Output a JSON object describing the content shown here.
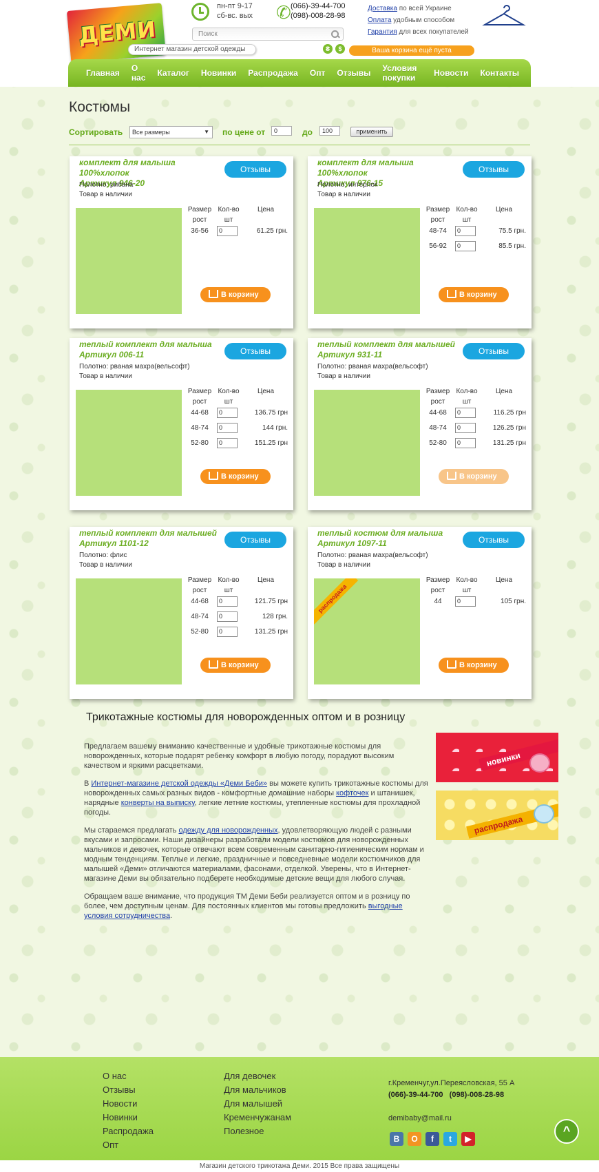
{
  "header": {
    "logo_text": "ДЕМИ",
    "tagline": "Интернет магазин детской одежды",
    "hours_line1": "пн-пт 9-17",
    "hours_line2": "сб-вс. вых",
    "phone1": "(066)-39-44-700",
    "phone2": "(098)-008-28-98",
    "search_placeholder": "Поиск",
    "currency1": "₴",
    "currency2": "$",
    "cart_status": "Ваша корзина ещё пуста",
    "links": [
      {
        "link": "Доставка",
        "rest": " по всей Украине"
      },
      {
        "link": "Оплата",
        "rest": " удобным способом"
      },
      {
        "link": "Гарантия",
        "rest": " для всех покупателей"
      }
    ]
  },
  "nav": [
    "Главная",
    "О нас",
    "Каталог",
    "Новинки",
    "Распродажа",
    "Опт",
    "Отзывы",
    "Условия покупки",
    "Новости",
    "Контакты"
  ],
  "page_title": "Костюмы",
  "sort": {
    "label": "Сортировать",
    "size_select": "Все размеры",
    "price_from_label": "по цене от",
    "price_from": "0",
    "price_to_label": "до",
    "price_to": "100",
    "apply": "применить"
  },
  "table_headers": {
    "size_line1": "Размер",
    "size_line2": "рост",
    "qty_line1": "Кол-во",
    "qty_line2": "шт",
    "price": "Цена"
  },
  "reviews_label": "Отзывы",
  "cart_label": "В корзину",
  "products": [
    {
      "title": "комплект для малыша 100%хлопок",
      "sku": "Артикул 946-20",
      "fabric": "Полотно: рибана",
      "stock": "Товар в наличии",
      "rows": [
        {
          "size": "36-56",
          "qty": "0",
          "price": "61.25 грн."
        }
      ]
    },
    {
      "title": "комплект для малыша 100%хлопок",
      "sku": "Артикул 976-15",
      "fabric": "Полотно: интерлок",
      "stock": "Товар в наличии",
      "rows": [
        {
          "size": "48-74",
          "qty": "0",
          "price": "75.5 грн."
        },
        {
          "size": "56-92",
          "qty": "0",
          "price": "85.5 грн."
        }
      ]
    },
    {
      "title": "теплый комплект для малыша",
      "sku": "Артикул 006-11",
      "fabric": "Полотно: рваная махра(вельсофт)",
      "stock": "Товар в наличии",
      "rows": [
        {
          "size": "44-68",
          "qty": "0",
          "price": "136.75 грн"
        },
        {
          "size": "48-74",
          "qty": "0",
          "price": "144 грн."
        },
        {
          "size": "52-80",
          "qty": "0",
          "price": "151.25 грн"
        }
      ]
    },
    {
      "title": "теплый комплект для малышей",
      "sku": "Артикул 931-11",
      "fabric": "Полотно: рваная махра(вельсофт)",
      "stock": "Товар в наличии",
      "rows": [
        {
          "size": "44-68",
          "qty": "0",
          "price": "116.25 грн"
        },
        {
          "size": "48-74",
          "qty": "0",
          "price": "126.25 грн"
        },
        {
          "size": "52-80",
          "qty": "0",
          "price": "131.25 грн"
        }
      ]
    },
    {
      "title": "теплый комплект для малышей",
      "sku": "Артикул 1101-12",
      "fabric": "Полотно: флис",
      "stock": "Товар в наличии",
      "rows": [
        {
          "size": "44-68",
          "qty": "0",
          "price": "121.75 грн"
        },
        {
          "size": "48-74",
          "qty": "0",
          "price": "128 грн."
        },
        {
          "size": "52-80",
          "qty": "0",
          "price": "131.25 грн"
        }
      ]
    },
    {
      "title": "теплый костюм для малыша",
      "sku": "Артикул 1097-11",
      "fabric": "Полотно: рваная махра(вельсофт)",
      "stock": "Товар в наличии",
      "badge": "распродажа",
      "rows": [
        {
          "size": "44",
          "qty": "0",
          "price": "105 грн."
        }
      ]
    }
  ],
  "seo": {
    "title": "Трикотажные костюмы для новорожденных оптом и в розницу",
    "p1": "Предлагаем вашему вниманию качественные и удобные трикотажные костюмы для новорожденных, которые подарят ребенку комфорт в любую погоду, порадуют высоким качеством и яркими расцветками.",
    "p2_a": "В ",
    "p2_link1": "Интернет-магазине детской одежды «Деми Беби»",
    "p2_b": " вы можете купить трикотажные костюмы для новорожденных самых разных видов - комфортные домашние наборы ",
    "p2_link2": "кофточек",
    "p2_c": " и штанишек, нарядные ",
    "p2_link3": "конверты на выписку",
    "p2_d": ", легкие летние костюмы, утепленные костюмы для прохладной погоды.",
    "p3_a": "Мы стараемся предлагать ",
    "p3_link": "одежду для новорожденных",
    "p3_b": ", удовлетворяющую людей с разными вкусами и запросами. Наши дизайнеры разработали модели костюмов для новорожденных мальчиков и девочек, которые отвечают всем современным санитарно-гигиеническим нормам и модным тенденциям. Теплые и легкие, праздничные и повседневные модели костюмчиков для малышей «Деми» отличаются материалами, фасонами, отделкой. Уверены, что в Интернет-магазине Деми вы обязательно подберете необходимые детские вещи для любого случая.",
    "p4_a": "Обращаем ваше внимание, что продукция ТМ Деми Беби реализуется оптом и в розницу по более, чем доступным ценам. Для постоянных клиентов мы готовы предложить ",
    "p4_link": "выгодные условия сотрудничества",
    "p4_b": "."
  },
  "promos": [
    "новинки",
    "распродажа"
  ],
  "footer": {
    "col1": [
      "О нас",
      "Отзывы",
      "Новости",
      "Новинки",
      "Распродажа",
      "Опт"
    ],
    "col2": [
      "Для девочек",
      "Для мальчиков",
      "Для малышей",
      "Кременчужанам",
      "Полезное"
    ],
    "address": "г.Кременчуг,ул.Переясловская, 55 А",
    "phones": "(066)-39-44-700   (098)-008-28-98",
    "email": "demibaby@mail.ru",
    "social": [
      {
        "name": "vk-icon",
        "glyph": "В",
        "color": "#4a76a8"
      },
      {
        "name": "odnoklassniki-icon",
        "glyph": "O",
        "color": "#f29422"
      },
      {
        "name": "facebook-icon",
        "glyph": "f",
        "color": "#3b5998"
      },
      {
        "name": "twitter-icon",
        "glyph": "t",
        "color": "#2aa8e0"
      },
      {
        "name": "youtube-icon",
        "glyph": "▶",
        "color": "#d3222a"
      }
    ],
    "to_top": "^",
    "copyright": "Магазин детского трикотажа Деми. 2015 Все права защищены"
  }
}
